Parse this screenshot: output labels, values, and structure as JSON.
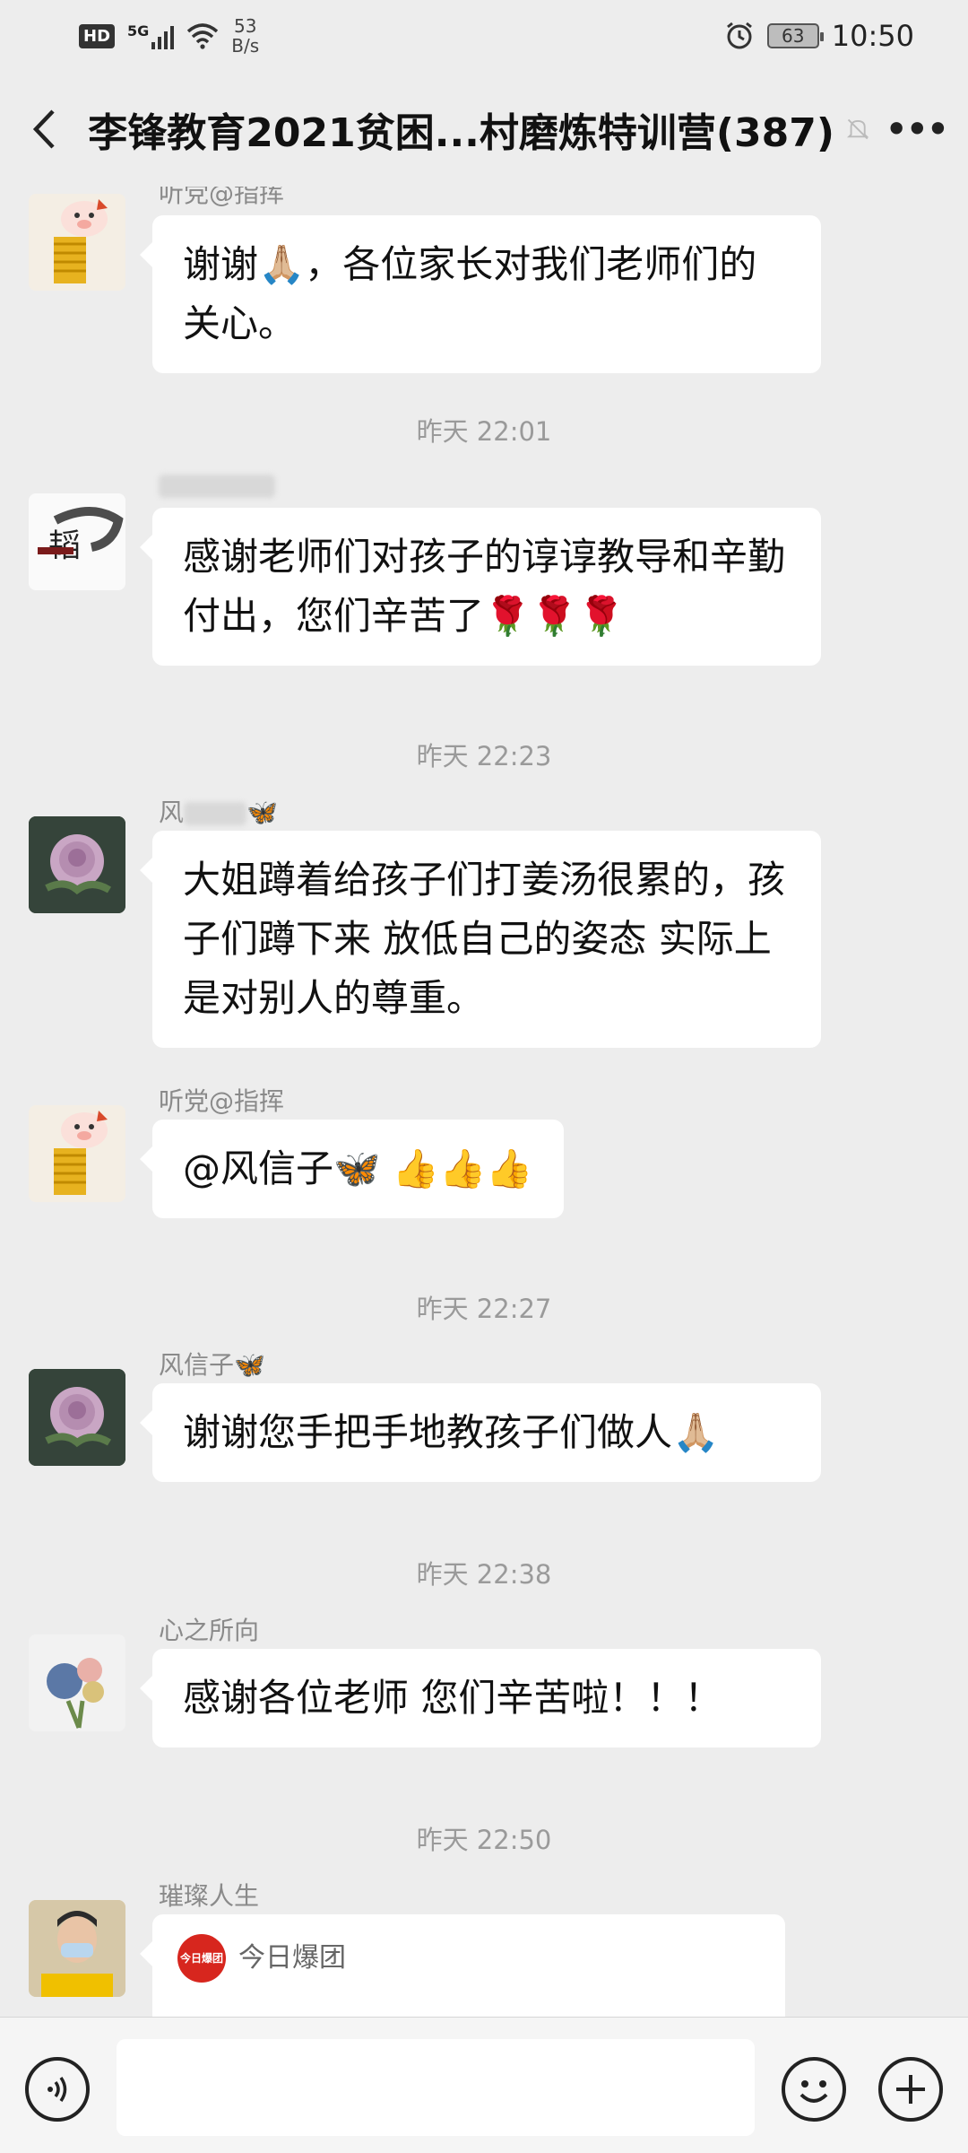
{
  "status_bar": {
    "hd": "HD",
    "signal": "5G",
    "net_speed_value": "53",
    "net_speed_unit": "B/s",
    "battery": "63",
    "time": "10:50"
  },
  "header": {
    "title": "李锋教育2021贫困...村磨炼特训营(387)"
  },
  "messages": [
    {
      "sender": "听党@指挥",
      "text": "谢谢🙏🏼，各位家长对我们老师们的关心。"
    },
    {
      "time": "昨天 22:01"
    },
    {
      "sender": "",
      "text": "感谢老师们对孩子的谆谆教导和辛勤付出，您们辛苦了🌹🌹🌹"
    },
    {
      "time": "昨天 22:23"
    },
    {
      "sender": "风",
      "text": "大姐蹲着给孩子们打姜汤很累的，孩子们蹲下来 放低自己的姿态 实际上是对别人的尊重。"
    },
    {
      "sender": "听党@指挥",
      "text": "@风信子🦋 👍👍👍"
    },
    {
      "time": "昨天 22:27"
    },
    {
      "sender": "风信子🦋",
      "text": "谢谢您手把手地教孩子们做人🙏🏼"
    },
    {
      "time": "昨天 22:38"
    },
    {
      "sender": "心之所向",
      "text": "感谢各位老师 您们辛苦啦！！！"
    },
    {
      "time": "昨天 22:50"
    },
    {
      "sender": "璀璨人生",
      "card_source": "今日爆团",
      "card_logo": "今日爆团"
    }
  ],
  "colors": {
    "background": "#ededed",
    "bubble": "#ffffff",
    "timestamp": "#9a9a9a",
    "sender": "#8a8a8a"
  }
}
